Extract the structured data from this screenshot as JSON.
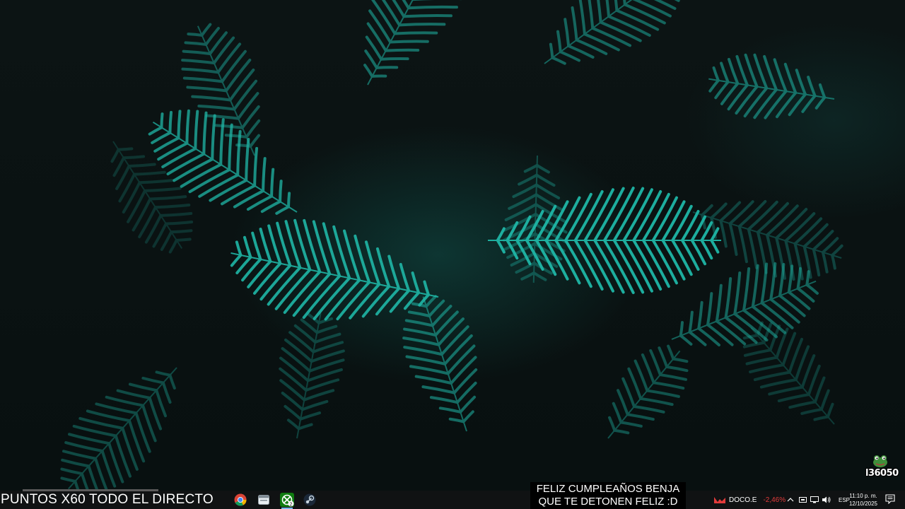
{
  "widget": {
    "label": "l36050",
    "icon": "frog-avatar-icon"
  },
  "taskbar": {
    "ticker_text": "PUNTOS X60 TODO EL DIRECTO",
    "apps": [
      {
        "name": "chrome",
        "icon": "chrome-icon"
      },
      {
        "name": "app",
        "icon": "app-window-icon"
      },
      {
        "name": "xbox",
        "icon": "xbox-icon",
        "badge": "2"
      },
      {
        "name": "steam",
        "icon": "steam-icon"
      }
    ],
    "overlay": {
      "line1": "FELIZ CUMPLEAÑOS BENJA",
      "line2": "QUE TE DETONEN FELIZ :D"
    },
    "stock": {
      "icon": "stock-down-icon",
      "symbol": "DOCO.E",
      "change": "-2,46%"
    },
    "tray": {
      "icons": [
        "chevron-up-icon",
        "usb-icon",
        "network-icon",
        "volume-icon"
      ],
      "language": "ESP",
      "time": "11:10 p. m.",
      "date": "12/10/2025"
    }
  },
  "colors": {
    "taskbar_bg": "#101213",
    "fern": "#1fb6a6",
    "accent_blue": "#76b9ed",
    "negative": "#e23b3b"
  }
}
